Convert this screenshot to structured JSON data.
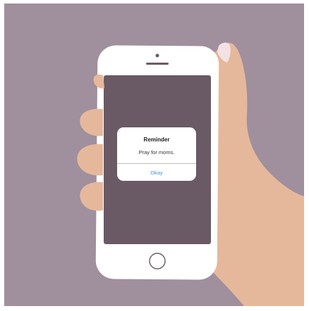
{
  "alert": {
    "title": "Reminder",
    "message": "Pray for moms.",
    "button_label": "Okay"
  },
  "colors": {
    "background": "#a08f9d",
    "skin": "#e5b89b",
    "phone_body": "#ffffff",
    "screen": "#6a5a65",
    "nail": "#f4e1e4",
    "link": "#4a90d9"
  },
  "icons": [
    "front-camera-icon",
    "speaker-icon",
    "home-button-icon"
  ]
}
